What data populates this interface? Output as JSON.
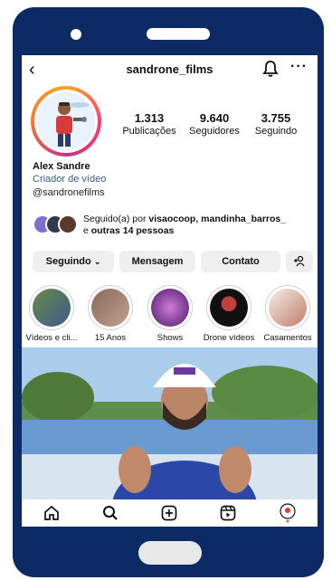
{
  "profile": {
    "username": "sandrone_films",
    "name": "Alex Sandre",
    "category": "Criador de vídeo",
    "handle": "@sandronefilms"
  },
  "stats": [
    {
      "value": "1.313",
      "label": "Publicações"
    },
    {
      "value": "9.640",
      "label": "Seguidores"
    },
    {
      "value": "3.755",
      "label": "Seguindo"
    }
  ],
  "followed_by": {
    "prefix": "Seguido(a) por ",
    "names": "visaocoop, mandinha_barros_",
    "connector": " e ",
    "others": "outras 14 pessoas"
  },
  "actions": {
    "following": "Seguindo",
    "message": "Mensagem",
    "contact": "Contato"
  },
  "highlights": [
    {
      "label": "Vídeos e cli..."
    },
    {
      "label": "15 Anos"
    },
    {
      "label": "Shows"
    },
    {
      "label": "Drone vídeos"
    },
    {
      "label": "Casamentos"
    }
  ],
  "icons": {
    "back": "arrow-left-icon",
    "notifications": "bell-icon",
    "more": "more-horizontal-icon",
    "home": "home-icon",
    "search": "search-icon",
    "create": "plus-square-icon",
    "reels": "reels-icon",
    "profile": "profile-avatar-icon"
  },
  "colors": {
    "phone_frame": "#0c2a63",
    "category_link": "#3a5a8a",
    "button_bg": "#efefef"
  }
}
